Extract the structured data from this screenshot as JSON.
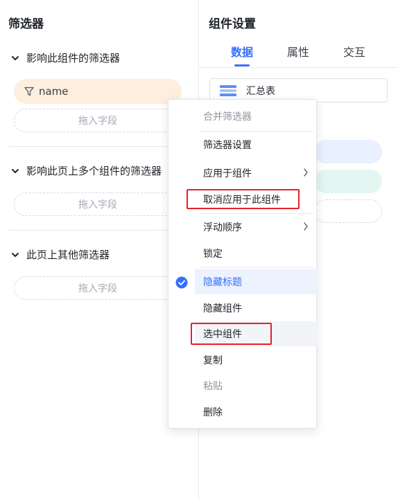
{
  "left": {
    "title": "筛选器",
    "section1": {
      "label": "影响此组件的筛选器",
      "pill": "name",
      "drop": "拖入字段"
    },
    "section2": {
      "label": "影响此页上多个组件的筛选器",
      "drop": "拖入字段"
    },
    "section3": {
      "label": "此页上其他筛选器",
      "drop": "拖入字段"
    }
  },
  "right": {
    "title": "组件设置",
    "tabs": [
      {
        "label": "数据"
      },
      {
        "label": "属性"
      },
      {
        "label": "交互"
      }
    ],
    "component_select": "汇总表"
  },
  "menu": {
    "items": [
      {
        "label": "合并筛选器",
        "disabled": true
      },
      {
        "label": "筛选器设置"
      },
      {
        "label": "应用于组件",
        "submenu": true
      },
      {
        "label": "取消应用于此组件",
        "highlighted": true
      },
      {
        "label": "浮动顺序",
        "submenu": true
      },
      {
        "label": "锁定"
      },
      {
        "label": "隐藏标题",
        "checked": true
      },
      {
        "label": "隐藏组件"
      },
      {
        "label": "选中组件",
        "highlighted": true
      },
      {
        "label": "复制"
      },
      {
        "label": "粘贴",
        "disabled": true
      },
      {
        "label": "删除"
      }
    ]
  },
  "colors": {
    "accent": "#3370ff",
    "highlight_border": "#e5202a",
    "pill_bg": "#fdeedd"
  },
  "icons": {
    "chevron": "chevron-down-icon",
    "filter": "filter-icon",
    "table": "table-icon",
    "check": "check-circle-icon",
    "submenu": "chevron-right-icon"
  }
}
